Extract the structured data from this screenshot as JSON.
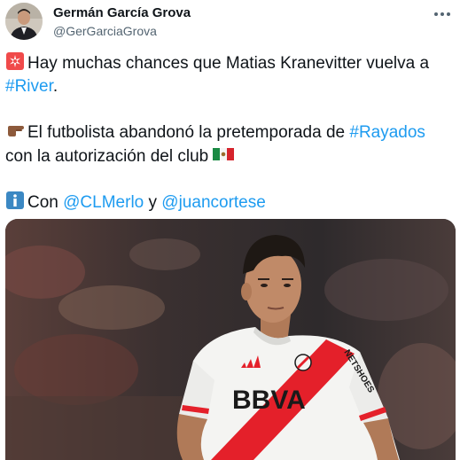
{
  "author": {
    "name": "Germán García Grova",
    "handle": "@GerGarciaGrova",
    "avatar_icon": "profile-photo"
  },
  "more_icon": "ellipsis-icon",
  "tweet": {
    "line1": {
      "emoji": "siren-emoji",
      "text": "Hay muchas chances que Matias Kranevitter vuelva a ",
      "hashtag": "#River",
      "tail": "."
    },
    "line2": {
      "emoji": "pointing-hand-emoji",
      "text": "El futbolista abandonó la pretemporada de ",
      "hashtag": "#Rayados",
      "tail": " con la autorización del club ",
      "flag": "mexico-flag-emoji"
    },
    "line3": {
      "emoji": "information-emoji",
      "text": "Con ",
      "mention1": "@CLMerlo",
      "connector": " y ",
      "mention2": "@juancortese"
    }
  },
  "media": {
    "jersey_brand": "BBVA",
    "sleeve_brand": "NETSHOES",
    "colors": {
      "link": "#1d9bf0",
      "stripe": "#e4202a",
      "shirt": "#f4f4f2"
    }
  }
}
